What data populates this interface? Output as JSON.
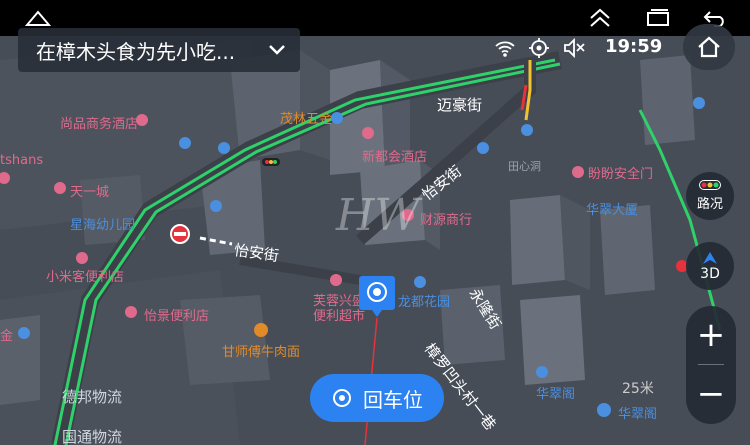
{
  "colors": {
    "accent": "#2c82f0",
    "traffic_green": "#2fd16a",
    "traffic_yellow": "#f2c230",
    "traffic_red": "#e5323b",
    "poi_pink": "#e06a8c",
    "road_text": "#ffffff"
  },
  "system_bar": {
    "icons": [
      "home-outline-icon",
      "chevron-double-up-icon",
      "window-icon",
      "back-icon"
    ]
  },
  "destination": {
    "label": "在樟木头食为先小吃..."
  },
  "status": {
    "time": "19:59",
    "icons": [
      "wifi-icon",
      "gps-icon",
      "mute-icon"
    ]
  },
  "roads": {
    "r1": "迈豪街",
    "r2": "怡安街",
    "r3": "怡安街",
    "r4": "永隆街",
    "r5": "樟罗凹头村一巷"
  },
  "pois": {
    "p1": "尚品商务酒店",
    "p2": "茂林五金",
    "p3": "新都会酒店",
    "p4": "tshans",
    "p5": "天一城",
    "p6": "星海幼儿园",
    "p7": "小米客便利店",
    "p8": "怡景便利店",
    "p9": "芙蓉兴盛",
    "p10": "便利超市",
    "p11": "龙都花园",
    "p12": "甘师傅牛肉面",
    "p13": "德邦物流",
    "p14": "国通物流",
    "p15": "财源商行",
    "p16": "田心洞",
    "p17": "盼盼安全门",
    "p18": "华翠大厦",
    "p19": "华翠阁",
    "p20": "华翠阁",
    "p21": "金"
  },
  "controls": {
    "traffic_label": "路况",
    "view_label": "3D",
    "zoom_in": "+",
    "zoom_out": "−"
  },
  "return_button": {
    "label": "回车位"
  },
  "scale": {
    "label": "25米"
  },
  "watermark": "HW"
}
